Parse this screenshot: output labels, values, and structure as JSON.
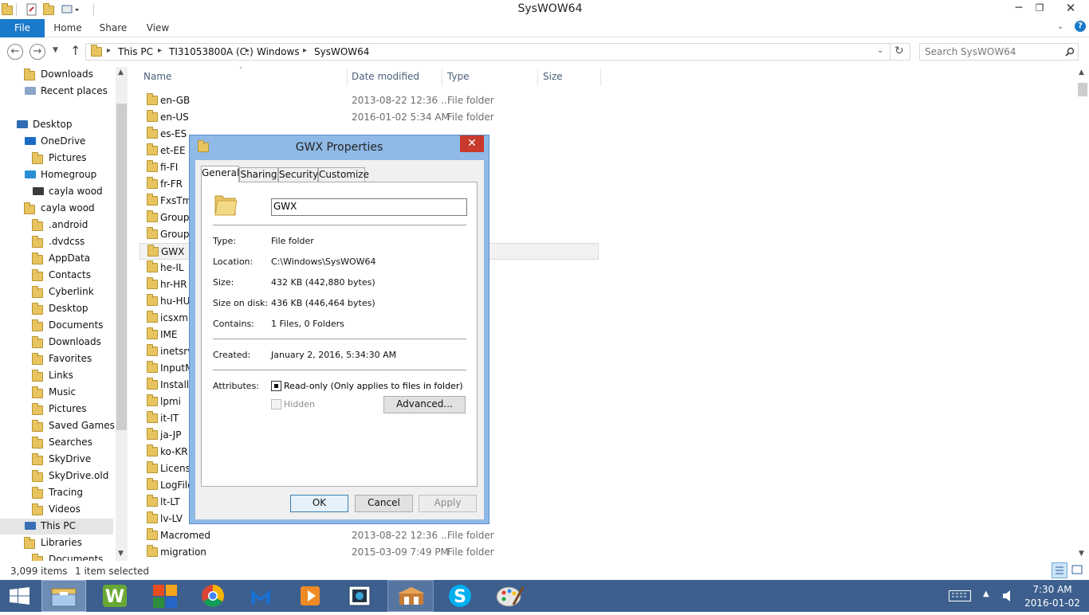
{
  "window": {
    "title": "SysWOW64",
    "minimize": "─",
    "restore": "❐",
    "close": "✕"
  },
  "ribbon": {
    "tabs": [
      "File",
      "Home",
      "Share",
      "View"
    ],
    "help": "?"
  },
  "address": {
    "crumbs": [
      "This PC",
      "TI31053800A (C:)",
      "Windows",
      "SysWOW64"
    ],
    "search_placeholder": "Search SysWOW64"
  },
  "nav": {
    "items": [
      {
        "label": "Downloads",
        "icon": "downloads-folder-icon"
      },
      {
        "label": "Recent places",
        "icon": "recent-places-icon"
      },
      {
        "label": "Desktop",
        "icon": "desktop-icon"
      },
      {
        "label": "OneDrive",
        "icon": "onedrive-cloud-icon"
      },
      {
        "label": "Pictures",
        "icon": "folder-icon"
      },
      {
        "label": "Homegroup",
        "icon": "homegroup-icon"
      },
      {
        "label": "cayla wood",
        "icon": "user-avatar-icon"
      },
      {
        "label": "cayla wood",
        "icon": "user-folder-icon"
      },
      {
        "label": ".android",
        "icon": "folder-icon"
      },
      {
        "label": ".dvdcss",
        "icon": "folder-icon"
      },
      {
        "label": "AppData",
        "icon": "folder-icon"
      },
      {
        "label": "Contacts",
        "icon": "contacts-icon"
      },
      {
        "label": "Cyberlink",
        "icon": "folder-icon"
      },
      {
        "label": "Desktop",
        "icon": "folder-icon"
      },
      {
        "label": "Documents",
        "icon": "documents-icon"
      },
      {
        "label": "Downloads",
        "icon": "downloads-folder-icon"
      },
      {
        "label": "Favorites",
        "icon": "favorites-icon"
      },
      {
        "label": "Links",
        "icon": "links-icon"
      },
      {
        "label": "Music",
        "icon": "music-icon"
      },
      {
        "label": "Pictures",
        "icon": "pictures-icon"
      },
      {
        "label": "Saved Games",
        "icon": "saved-games-icon"
      },
      {
        "label": "Searches",
        "icon": "searches-icon"
      },
      {
        "label": "SkyDrive",
        "icon": "folder-icon"
      },
      {
        "label": "SkyDrive.old",
        "icon": "folder-icon"
      },
      {
        "label": "Tracing",
        "icon": "folder-icon"
      },
      {
        "label": "Videos",
        "icon": "videos-icon"
      },
      {
        "label": "This PC",
        "icon": "this-pc-icon"
      },
      {
        "label": "Libraries",
        "icon": "libraries-icon"
      },
      {
        "label": "Documents",
        "icon": "documents-icon"
      }
    ]
  },
  "list": {
    "columns": [
      "Name",
      "Date modified",
      "Type",
      "Size"
    ],
    "rows": [
      {
        "name": "en-GB",
        "date": "2013-08-22 12:36 ...",
        "type": "File folder"
      },
      {
        "name": "en-US",
        "date": "2016-01-02 5:34 AM",
        "type": "File folder"
      },
      {
        "name": "es-ES",
        "date": "",
        "type": ""
      },
      {
        "name": "et-EE",
        "date": "",
        "type": ""
      },
      {
        "name": "fi-FI",
        "date": "",
        "type": ""
      },
      {
        "name": "fr-FR",
        "date": "",
        "type": ""
      },
      {
        "name": "FxsTmp",
        "date": "",
        "type": ""
      },
      {
        "name": "GroupPolicy",
        "date": "",
        "type": ""
      },
      {
        "name": "GroupPolicyUsers",
        "date": "",
        "type": ""
      },
      {
        "name": "GWX",
        "date": "",
        "type": ""
      },
      {
        "name": "he-IL",
        "date": "",
        "type": ""
      },
      {
        "name": "hr-HR",
        "date": "",
        "type": ""
      },
      {
        "name": "hu-HU",
        "date": "",
        "type": ""
      },
      {
        "name": "icsxml",
        "date": "",
        "type": ""
      },
      {
        "name": "IME",
        "date": "",
        "type": ""
      },
      {
        "name": "inetsrv",
        "date": "",
        "type": ""
      },
      {
        "name": "InputMethod",
        "date": "",
        "type": ""
      },
      {
        "name": "InstallShield",
        "date": "",
        "type": ""
      },
      {
        "name": "lpmi",
        "date": "",
        "type": ""
      },
      {
        "name": "it-IT",
        "date": "",
        "type": ""
      },
      {
        "name": "ja-JP",
        "date": "",
        "type": ""
      },
      {
        "name": "ko-KR",
        "date": "",
        "type": ""
      },
      {
        "name": "Licenses",
        "date": "",
        "type": ""
      },
      {
        "name": "LogFiles",
        "date": "",
        "type": ""
      },
      {
        "name": "lt-LT",
        "date": "",
        "type": ""
      },
      {
        "name": "lv-LV",
        "date": "",
        "type": ""
      },
      {
        "name": "Macromed",
        "date": "2013-08-22 12:36 ...",
        "type": "File folder"
      },
      {
        "name": "migration",
        "date": "2015-03-09 7:49 PM",
        "type": "File folder"
      }
    ]
  },
  "status": {
    "count": "3,099 items",
    "selected": "1 item selected"
  },
  "dialog": {
    "title": "GWX Properties",
    "tabs": [
      "General",
      "Sharing",
      "Security",
      "Customize"
    ],
    "name_value": "GWX",
    "props": [
      {
        "label": "Type:",
        "value": "File folder"
      },
      {
        "label": "Location:",
        "value": "C:\\Windows\\SysWOW64"
      },
      {
        "label": "Size:",
        "value": "432 KB (442,880 bytes)"
      },
      {
        "label": "Size on disk:",
        "value": "436 KB (446,464 bytes)"
      },
      {
        "label": "Contains:",
        "value": "1 Files, 0 Folders"
      },
      {
        "label": "Created:",
        "value": "January 2, 2016, 5:34:30 AM"
      }
    ],
    "attributes_label": "Attributes:",
    "readonly_label": "Read-only (Only applies to files in folder)",
    "hidden_label": "Hidden",
    "advanced_label": "Advanced...",
    "ok": "OK",
    "cancel": "Cancel",
    "apply": "Apply"
  },
  "clock": {
    "time": "7:30 AM",
    "date": "2016-01-02"
  },
  "colors": {
    "accent": "#1979ca",
    "taskbar": "#3c5f8e",
    "dialog_frame": "#8fb9e6",
    "close_red": "#c7392a"
  }
}
